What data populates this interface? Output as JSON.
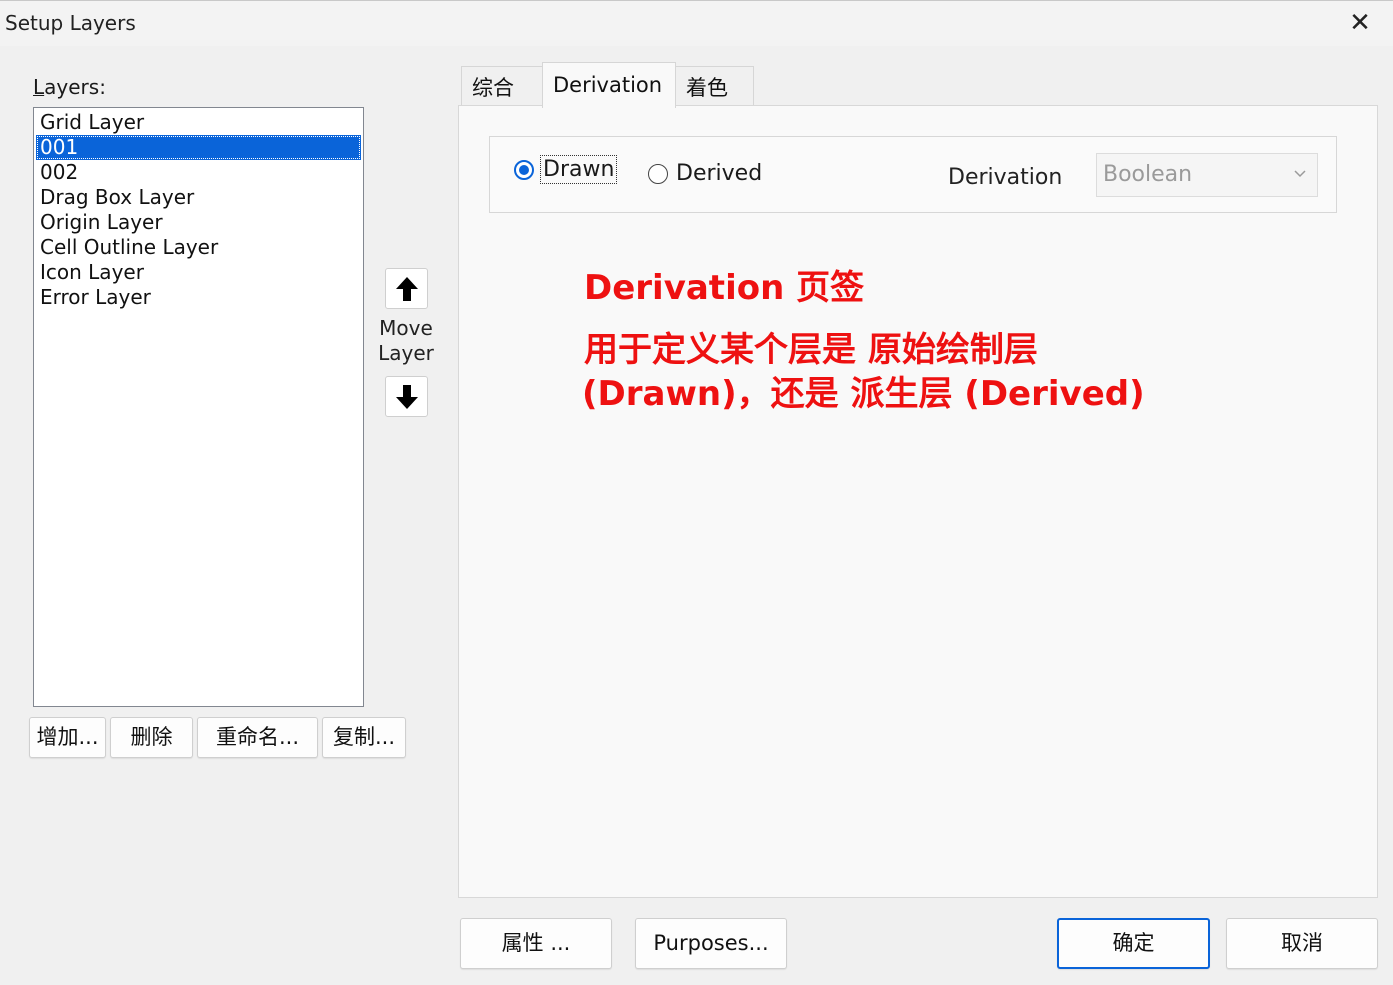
{
  "window": {
    "title": "Setup Layers",
    "close_glyph": "✕"
  },
  "layers_panel": {
    "label": "Layers:",
    "items": [
      {
        "label": "Grid Layer",
        "selected": false
      },
      {
        "label": "001",
        "selected": true
      },
      {
        "label": "002",
        "selected": false
      },
      {
        "label": "Drag Box Layer",
        "selected": false
      },
      {
        "label": "Origin Layer",
        "selected": false
      },
      {
        "label": "Cell Outline Layer",
        "selected": false
      },
      {
        "label": "Icon Layer",
        "selected": false
      },
      {
        "label": "Error Layer",
        "selected": false
      }
    ],
    "buttons": {
      "add": "增加...",
      "delete": "删除",
      "rename": "重命名...",
      "copy": "复制..."
    }
  },
  "move_layer": {
    "label_line1": "Move",
    "label_line2": "Layer",
    "up_icon": "arrow-up-icon",
    "down_icon": "arrow-down-icon"
  },
  "tabs": [
    {
      "label": "综合",
      "active": false
    },
    {
      "label": "Derivation",
      "active": true
    },
    {
      "label": "着色",
      "active": false
    }
  ],
  "derivation_tab": {
    "radio_drawn": {
      "label": "Drawn",
      "checked": true
    },
    "radio_derived": {
      "label": "Derived",
      "checked": false
    },
    "derivation_label": "Derivation",
    "derivation_select": {
      "value": "Boolean",
      "disabled": true
    }
  },
  "annotation": {
    "line1": "Derivation 页签",
    "line2": "用于定义某个层是 原始绘制层",
    "line3": "(Drawn)，还是 派生层 (Derived)",
    "color": "#ee1111"
  },
  "footer_buttons": {
    "properties": "属性 ...",
    "purposes": "Purposes...",
    "ok": "确定",
    "cancel": "取消"
  },
  "colors": {
    "selection": "#0a64d9",
    "ok_border": "#0a64d9"
  }
}
